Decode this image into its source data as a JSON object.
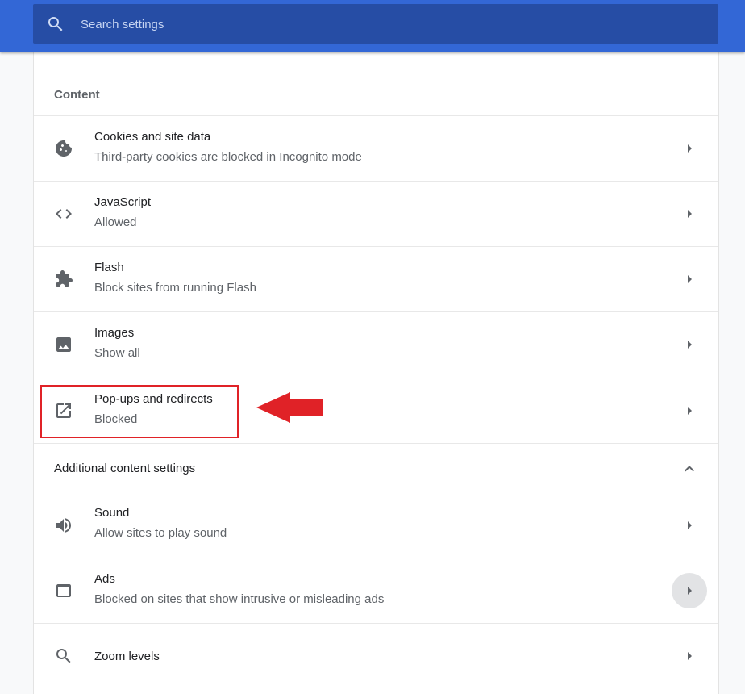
{
  "search": {
    "placeholder": "Search settings"
  },
  "content": {
    "title": "Content",
    "items": [
      {
        "icon": "cookie-icon",
        "label": "Cookies and site data",
        "sub": "Third-party cookies are blocked in Incognito mode"
      },
      {
        "icon": "code-icon",
        "label": "JavaScript",
        "sub": "Allowed"
      },
      {
        "icon": "puzzle-icon",
        "label": "Flash",
        "sub": "Block sites from running Flash"
      },
      {
        "icon": "image-icon",
        "label": "Images",
        "sub": "Show all"
      },
      {
        "icon": "open-in-new-icon",
        "label": "Pop-ups and redirects",
        "sub": "Blocked"
      }
    ]
  },
  "additional": {
    "title": "Additional content settings",
    "items": [
      {
        "icon": "volume-icon",
        "label": "Sound",
        "sub": "Allow sites to play sound"
      },
      {
        "icon": "ads-window-icon",
        "label": "Ads",
        "sub": "Blocked on sites that show intrusive or misleading ads"
      },
      {
        "icon": "search-icon",
        "label": "Zoom levels"
      }
    ]
  },
  "colors": {
    "topbar": "#3367d6",
    "search_box": "#264da5",
    "highlight": "#e02227",
    "icon": "#5f6368"
  }
}
